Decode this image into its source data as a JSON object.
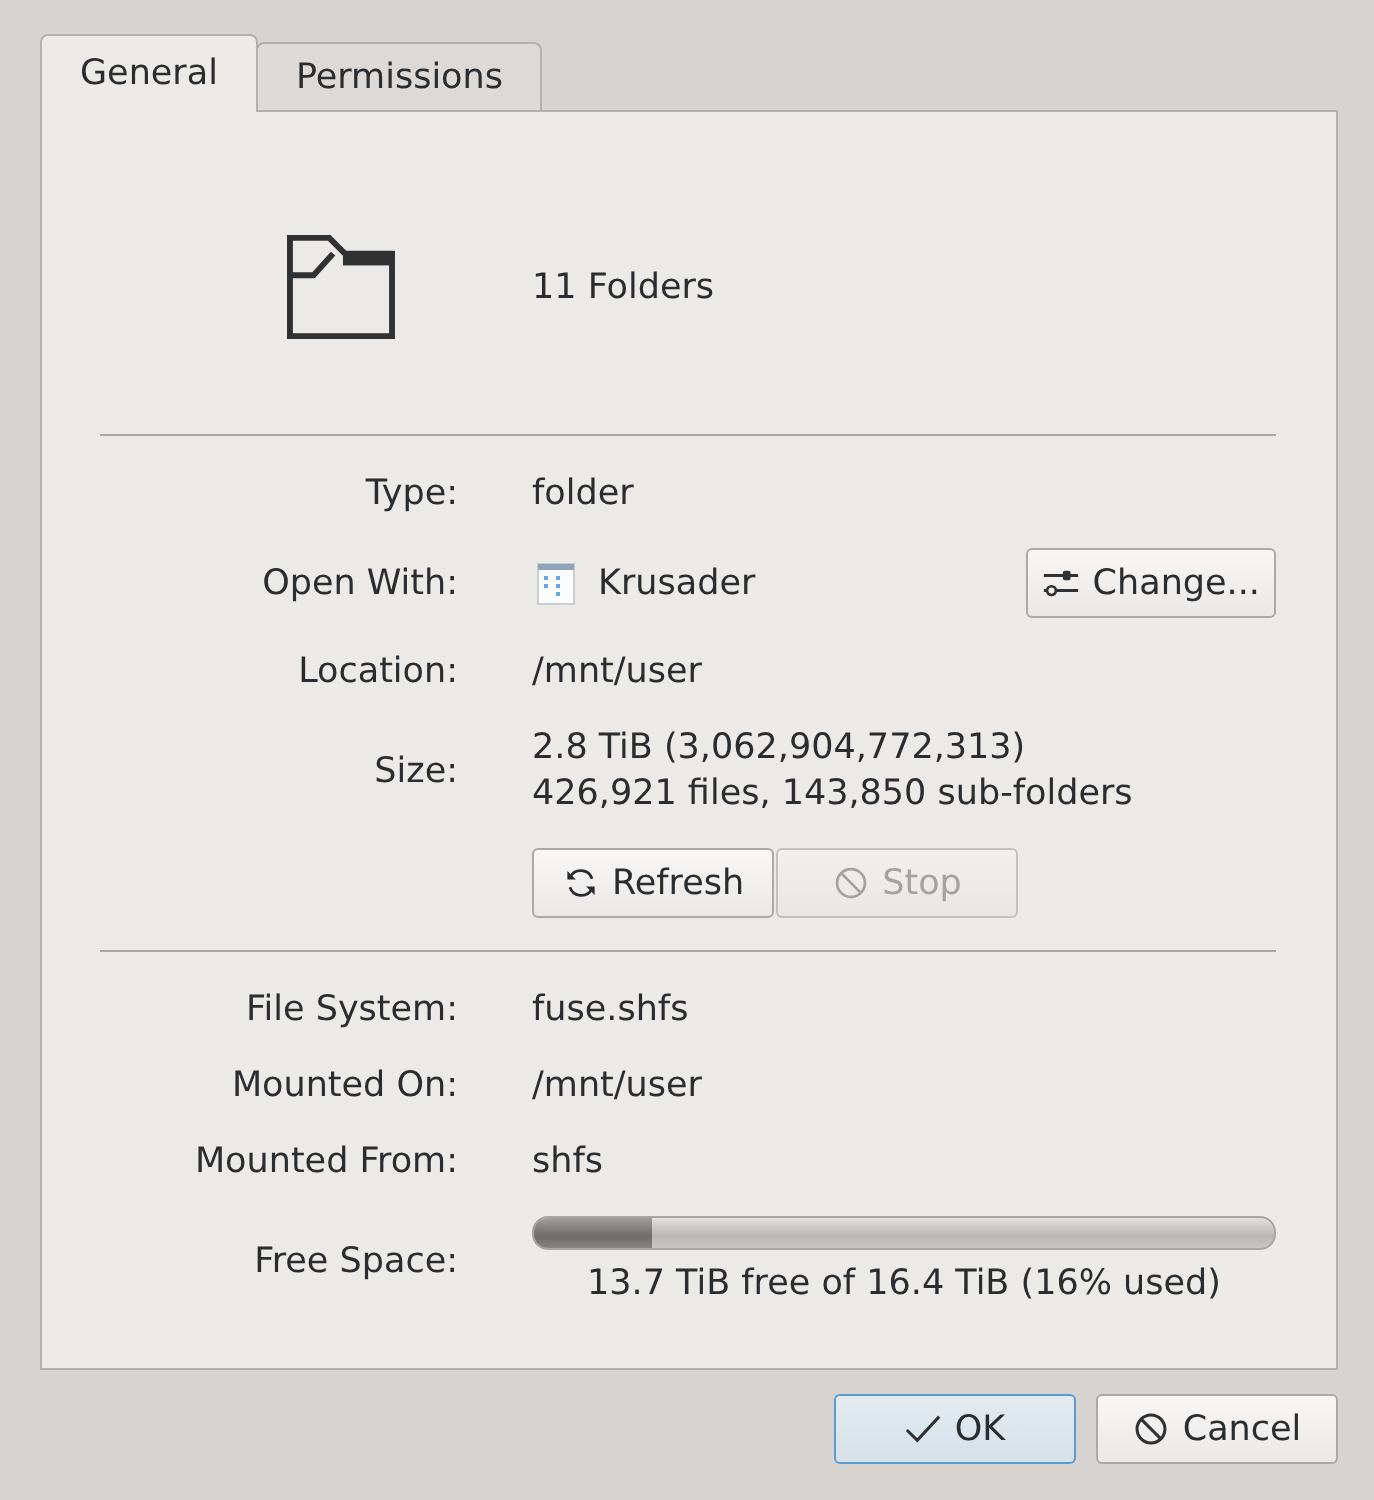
{
  "tabs": [
    {
      "label": "General",
      "selected": true
    },
    {
      "label": "Permissions",
      "selected": false
    }
  ],
  "header": {
    "title": "11 Folders"
  },
  "sections": [
    {
      "rows": [
        {
          "kind": "text",
          "label": "Type:",
          "value": "folder"
        },
        {
          "kind": "app",
          "label": "Open With:",
          "value": "Krusader",
          "button": {
            "label": "Change..."
          }
        },
        {
          "kind": "text",
          "label": "Location:",
          "value": "/mnt/user"
        },
        {
          "kind": "lines",
          "label": "Size:",
          "lines": [
            "2.8 TiB (3,062,904,772,313)",
            "426,921 files, 143,850 sub-folders"
          ]
        },
        {
          "kind": "actions",
          "buttons": [
            {
              "label": "Refresh",
              "disabled": false
            },
            {
              "label": "Stop",
              "disabled": true
            }
          ]
        }
      ]
    },
    {
      "rows": [
        {
          "kind": "text",
          "label": "File System:",
          "value": "fuse.shfs"
        },
        {
          "kind": "text",
          "label": "Mounted On:",
          "value": "/mnt/user"
        },
        {
          "kind": "text",
          "label": "Mounted From:",
          "value": "shfs"
        },
        {
          "kind": "meter",
          "label": "Free Space:",
          "level": 0.16,
          "caption": "13.7 TiB free of 16.4 TiB (16% used)"
        }
      ]
    }
  ],
  "buttons": [
    {
      "label": "OK",
      "default": true
    },
    {
      "label": "Cancel",
      "default": false
    }
  ]
}
